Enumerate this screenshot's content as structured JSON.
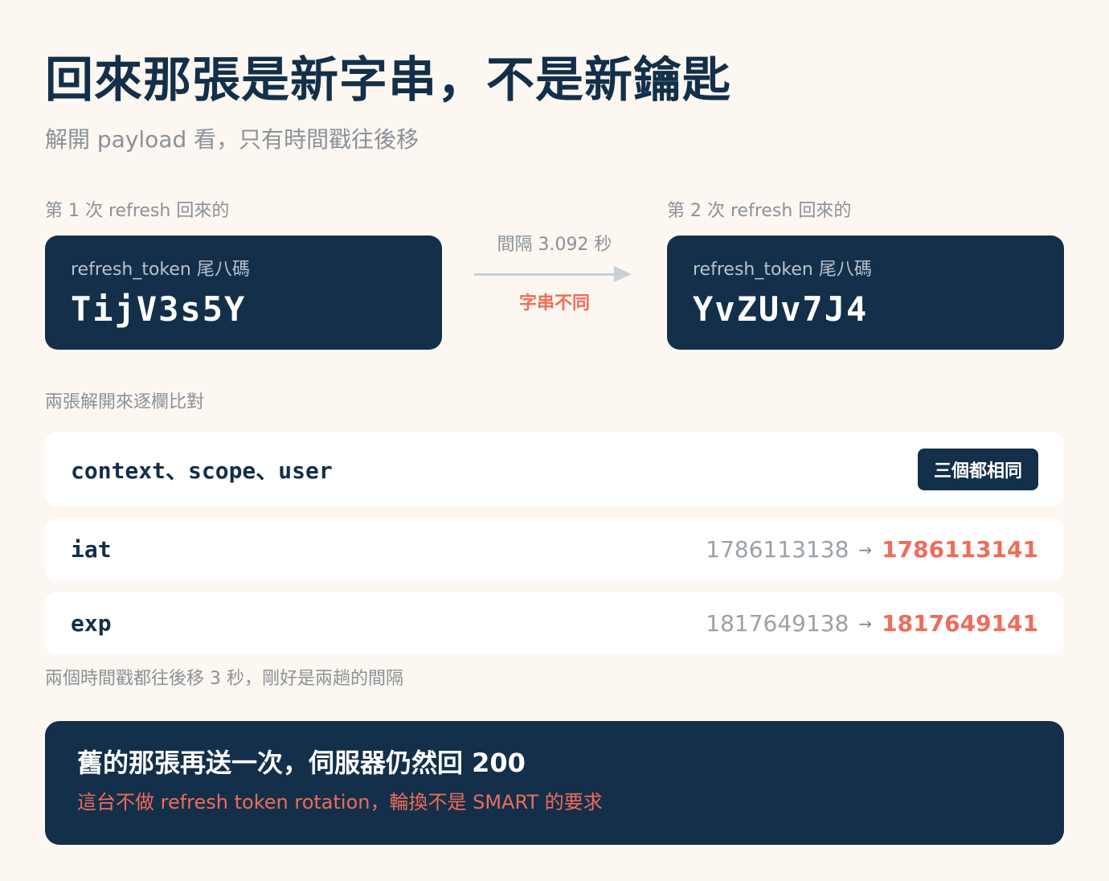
{
  "header": {
    "title": "回來那張是新字串，不是新鑰匙",
    "subtitle": "解開 payload 看，只有時間戳往後移"
  },
  "left_token": {
    "label": "第 1 次 refresh 回來的",
    "caption": "refresh_token 尾八碼",
    "value": "TijV3s5Y"
  },
  "right_token": {
    "label": "第 2 次 refresh 回來的",
    "caption": "refresh_token 尾八碼",
    "value": "YvZUv7J4"
  },
  "transition": {
    "interval": "間隔 3.092 秒",
    "note": "字串不同"
  },
  "comparison": {
    "label": "兩張解開來逐欄比對",
    "rows": [
      {
        "key": "context、scope、user",
        "badge": "三個都相同"
      },
      {
        "key": "iat",
        "old": "1786113138",
        "arrow": "→",
        "new": "1786113141"
      },
      {
        "key": "exp",
        "old": "1817649138",
        "arrow": "→",
        "new": "1817649141"
      }
    ],
    "footnote": "兩個時間戳都往後移 3 秒，剛好是兩趟的間隔"
  },
  "callout": {
    "title": "舊的那張再送一次，伺服器仍然回 200",
    "body": "這台不做 refresh token rotation，輪換不是 SMART 的要求"
  },
  "colors": {
    "background": "#fcf7f0",
    "navy": "#132f4a",
    "accent": "#ef6c5a",
    "muted": "#8a9199"
  }
}
